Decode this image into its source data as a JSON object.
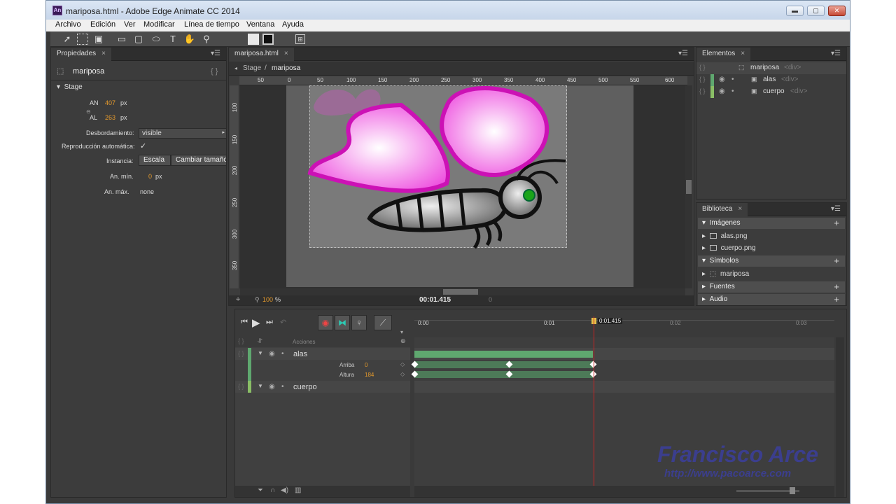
{
  "window": {
    "title": "mariposa.html - Adobe Edge Animate CC 2014",
    "app_icon": "An",
    "minimize": "▬",
    "maximize": "▢",
    "close": "✕"
  },
  "menu": [
    "Archivo",
    "Edición",
    "Ver",
    "Modificar",
    "Línea de tiempo",
    "Ventana",
    "Ayuda"
  ],
  "properties": {
    "tab": "Propiedades",
    "element": "mariposa",
    "section": "Stage",
    "width_label": "AN",
    "width_value": "407",
    "width_unit": "px",
    "height_label": "AL",
    "height_value": "263",
    "height_unit": "px",
    "overflow_label": "Desbordamiento:",
    "overflow_value": "visible",
    "autoplay_label": "Reproducción automática:",
    "autoplay_check": "✓",
    "instance_label": "Instancia:",
    "scale_button": "Escala",
    "resize_button": "Cambiar tamaño",
    "min_label": "An. mín.",
    "min_value": "0",
    "min_unit": "px",
    "max_label": "An. máx.",
    "max_value": "none"
  },
  "stage": {
    "tab": "mariposa.html",
    "breadcrumb_root": "Stage",
    "breadcrumb_sep": "/",
    "breadcrumb_current": "mariposa",
    "ruler_h": [
      "50",
      "0",
      "50",
      "100",
      "150",
      "200",
      "250",
      "300",
      "350",
      "400",
      "450",
      "500",
      "550",
      "600"
    ],
    "ruler_v": [
      "100",
      "150",
      "200",
      "250",
      "300",
      "350"
    ],
    "zoom": "100",
    "zoom_unit": "%",
    "time": "00:01.415",
    "time_secondary": "0"
  },
  "elements": {
    "tab": "Elementos",
    "items": [
      {
        "name": "mariposa",
        "tag": "<div>"
      },
      {
        "name": "alas",
        "tag": "<div>"
      },
      {
        "name": "cuerpo",
        "tag": "<div>"
      }
    ]
  },
  "library": {
    "tab": "Biblioteca",
    "images_header": "Imágenes",
    "images": [
      "alas.png",
      "cuerpo.png"
    ],
    "symbols_header": "Símbolos",
    "symbols": [
      "mariposa"
    ],
    "fonts_header": "Fuentes",
    "audio_header": "Audio"
  },
  "timeline": {
    "time_markers": [
      "0:00",
      "0:01",
      "0:02",
      "0:03"
    ],
    "playhead": "0:01.415",
    "actions_label": "Acciones",
    "layers": [
      {
        "name": "alas",
        "props": [
          {
            "name": "Arriba",
            "value": "0"
          },
          {
            "name": "Altura",
            "value": "184"
          }
        ]
      },
      {
        "name": "cuerpo"
      }
    ]
  },
  "watermark": {
    "name": "Francisco Arce",
    "url": "http://www.pacoarce.com"
  },
  "colors": {
    "accent": "#e59a2c",
    "layer_green": "#5fa86f",
    "playhead": "#cc2222"
  }
}
